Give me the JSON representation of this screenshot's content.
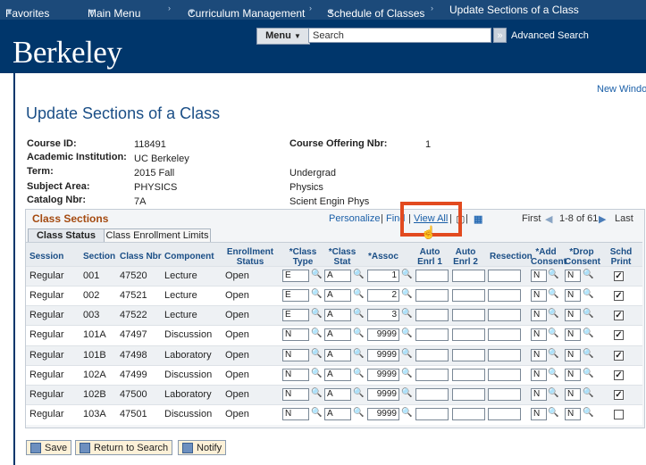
{
  "topnav": {
    "favorites": "Favorites",
    "main_menu": "Main Menu",
    "crumb1": "Curriculum Management",
    "crumb2": "Schedule of Classes",
    "crumb3": "Update Sections of a Class"
  },
  "header": {
    "logo": "Berkeley",
    "menu_label": "Menu",
    "search_value": "Search",
    "advanced_search": "Advanced Search"
  },
  "new_window": "New Window",
  "page_title": "Update Sections of a Class",
  "info": {
    "course_id_label": "Course ID:",
    "course_id": "118491",
    "institution_label": "Academic Institution:",
    "institution": "UC Berkeley",
    "term_label": "Term:",
    "term": "2015 Fall",
    "term_desc": "Undergrad",
    "subject_label": "Subject Area:",
    "subject": "PHYSICS",
    "subject_desc": "Physics",
    "catalog_label": "Catalog Nbr:",
    "catalog": "7A",
    "catalog_desc": "Scient Engin Phys",
    "offering_label": "Course Offering Nbr:",
    "offering": "1"
  },
  "grid": {
    "title": "Class Sections",
    "personalize": "Personalize",
    "find": "Find",
    "view_all": "View All",
    "first": "First",
    "range": "1-8 of 61",
    "last": "Last",
    "tabs": [
      "Class Status",
      "Class Enrollment Limits"
    ],
    "columns": [
      "Session",
      "Section",
      "Class Nbr",
      "Component",
      "Enrollment Status",
      "*Class Type",
      "*Class Stat",
      "*Assoc",
      "Auto Enrl 1",
      "Auto Enrl 2",
      "Resection",
      "*Add Consent",
      "*Drop Consent",
      "Schd Print"
    ],
    "rows": [
      {
        "session": "Regular",
        "section": "001",
        "class_nbr": "47520",
        "component": "Lecture",
        "status": "Open",
        "class_type": "E",
        "class_stat": "A",
        "assoc": "1",
        "add": "N",
        "drop": "N",
        "print": true
      },
      {
        "session": "Regular",
        "section": "002",
        "class_nbr": "47521",
        "component": "Lecture",
        "status": "Open",
        "class_type": "E",
        "class_stat": "A",
        "assoc": "2",
        "add": "N",
        "drop": "N",
        "print": true
      },
      {
        "session": "Regular",
        "section": "003",
        "class_nbr": "47522",
        "component": "Lecture",
        "status": "Open",
        "class_type": "E",
        "class_stat": "A",
        "assoc": "3",
        "add": "N",
        "drop": "N",
        "print": true
      },
      {
        "session": "Regular",
        "section": "101A",
        "class_nbr": "47497",
        "component": "Discussion",
        "status": "Open",
        "class_type": "N",
        "class_stat": "A",
        "assoc": "9999",
        "add": "N",
        "drop": "N",
        "print": true
      },
      {
        "session": "Regular",
        "section": "101B",
        "class_nbr": "47498",
        "component": "Laboratory",
        "status": "Open",
        "class_type": "N",
        "class_stat": "A",
        "assoc": "9999",
        "add": "N",
        "drop": "N",
        "print": true
      },
      {
        "session": "Regular",
        "section": "102A",
        "class_nbr": "47499",
        "component": "Discussion",
        "status": "Open",
        "class_type": "N",
        "class_stat": "A",
        "assoc": "9999",
        "add": "N",
        "drop": "N",
        "print": true
      },
      {
        "session": "Regular",
        "section": "102B",
        "class_nbr": "47500",
        "component": "Laboratory",
        "status": "Open",
        "class_type": "N",
        "class_stat": "A",
        "assoc": "9999",
        "add": "N",
        "drop": "N",
        "print": true
      },
      {
        "session": "Regular",
        "section": "103A",
        "class_nbr": "47501",
        "component": "Discussion",
        "status": "Open",
        "class_type": "N",
        "class_stat": "A",
        "assoc": "9999",
        "add": "N",
        "drop": "N",
        "print": false
      }
    ]
  },
  "buttons": {
    "save": "Save",
    "return": "Return to Search",
    "notify": "Notify"
  },
  "colors": {
    "brand_navy": "#00366b",
    "highlight": "#e24a1f",
    "button_bg": "#fdf1d8"
  }
}
